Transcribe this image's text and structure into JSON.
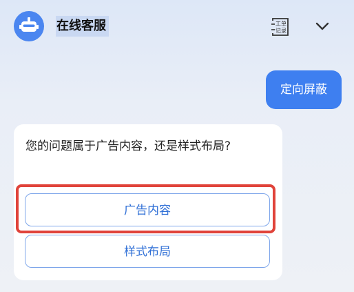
{
  "header": {
    "title": "在线客服",
    "worklog_icon_top": "工单",
    "worklog_icon_bottom": "记录",
    "icons": {
      "avatar": "robot-avatar-icon",
      "worklog": "work-order-record-icon",
      "collapse": "chevron-down-icon"
    }
  },
  "chat": {
    "user_message": "定向屏蔽",
    "bot_question": "您的问题属于广告内容，还是样式布局?",
    "options": [
      {
        "label": "广告内容"
      },
      {
        "label": "样式布局"
      }
    ]
  },
  "colors": {
    "accent": "#3e7ff0",
    "option_text": "#2f6fd6",
    "highlight": "#e0433a"
  }
}
